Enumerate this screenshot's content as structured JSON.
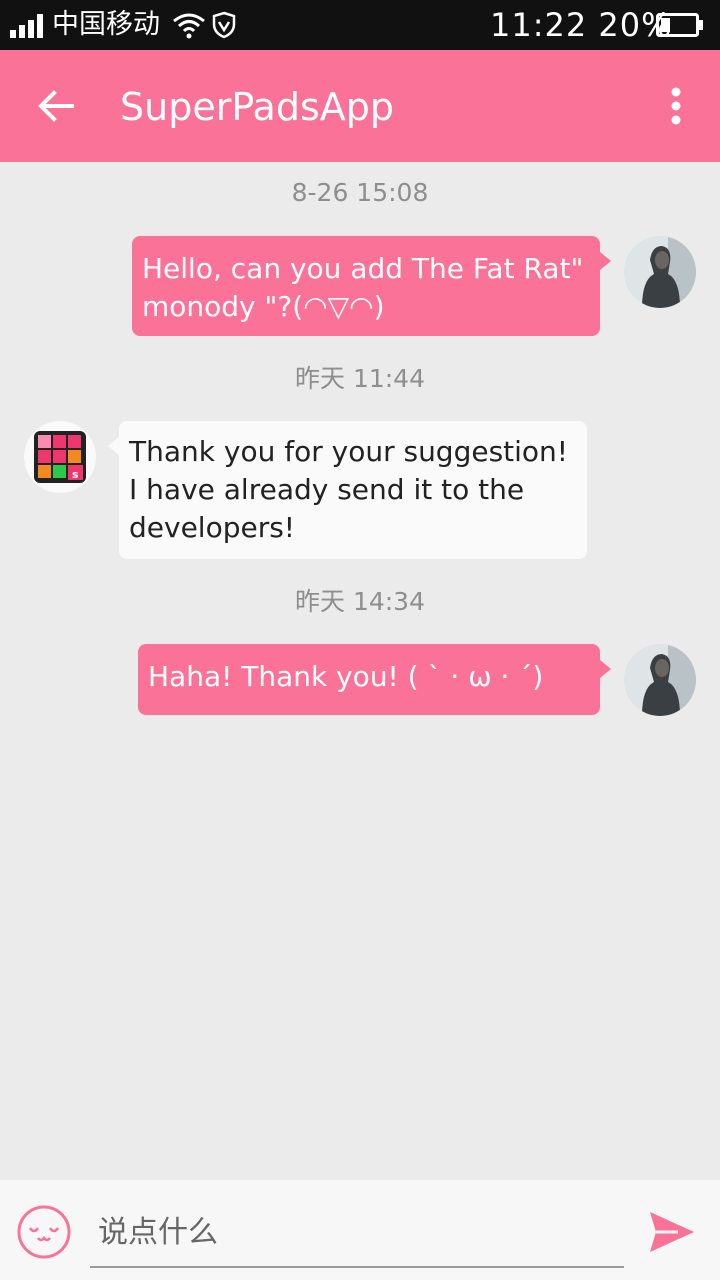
{
  "status_bar": {
    "carrier": "中国移动",
    "time": "11:22",
    "battery": "20%"
  },
  "app_bar": {
    "title": "SuperPadsApp",
    "back_icon": "arrow-left-icon",
    "menu_icon": "more-vertical-icon"
  },
  "messages": [
    {
      "timestamp": "8-26 15:08",
      "sender": "user",
      "text": "Hello, can you add The Fat Rat\" monody \"?(◠▽◠)"
    },
    {
      "timestamp": "昨天 11:44",
      "sender": "app",
      "text": "Thank you for your suggestion! I have already send it to the developers!"
    },
    {
      "timestamp": "昨天 14:34",
      "sender": "user",
      "text": "Haha!  Thank you! ( ` · ω · ´)"
    }
  ],
  "composer": {
    "placeholder": "说点什么",
    "emoji_icon": "emoji-icon",
    "send_icon": "send-icon"
  },
  "colors": {
    "accent": "#fb7299",
    "background": "#ebebeb",
    "status_bar": "#111111"
  }
}
